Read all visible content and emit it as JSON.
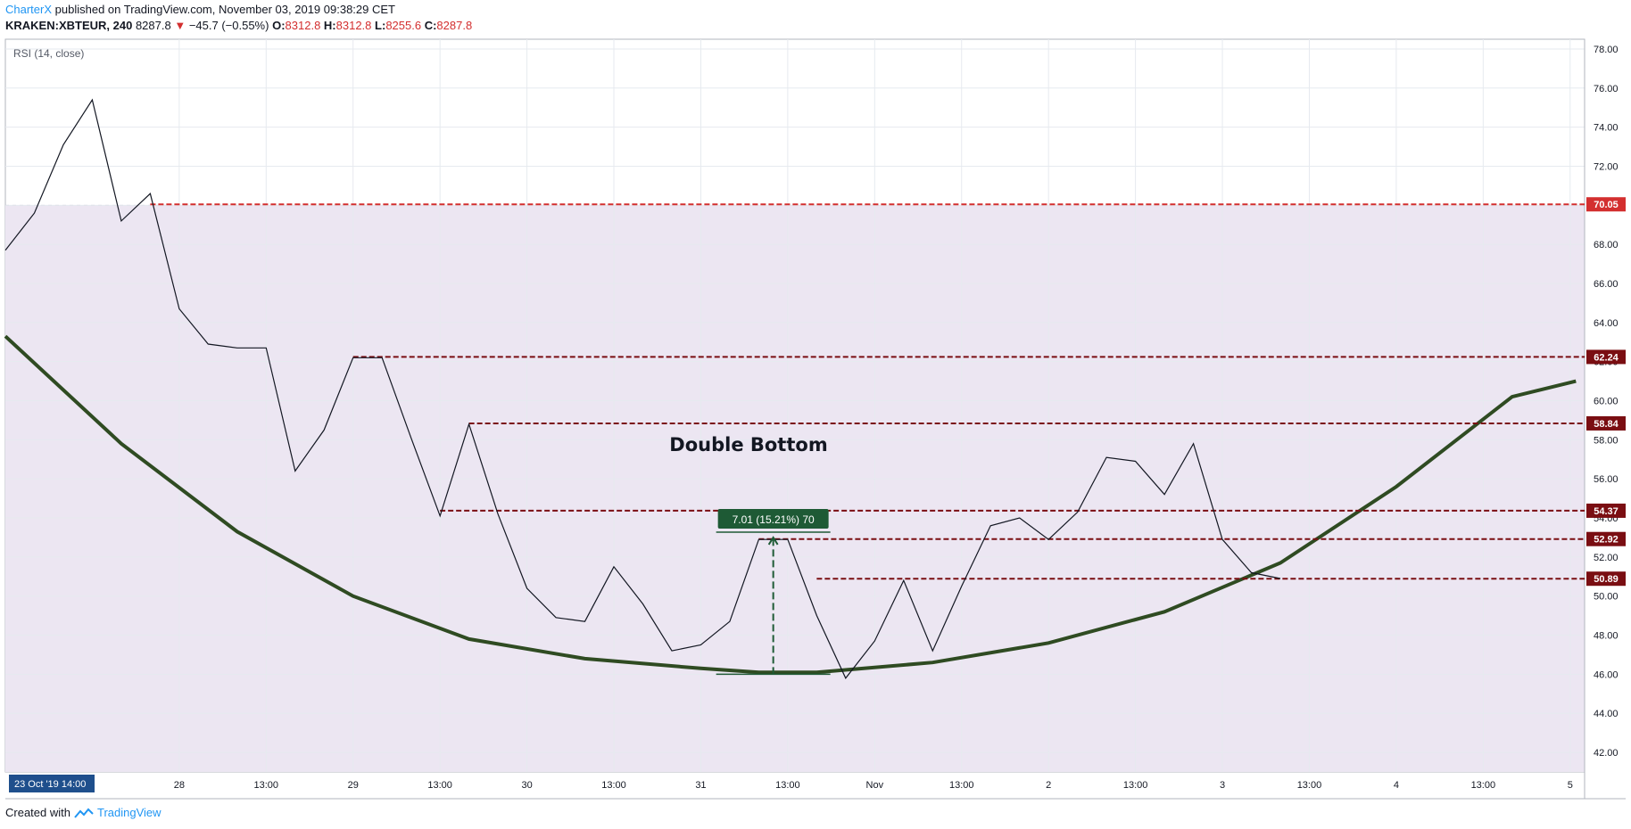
{
  "header": {
    "author": "CharterX",
    "published_text": "published on TradingView.com, November 03, 2019 09:38:29 CET",
    "symbol": "KRAKEN:XBTEUR, 240",
    "last": "8287.8",
    "change_arrow": "▼",
    "change": "−45.7 (−0.55%)",
    "open_label": "O:",
    "open": "8312.8",
    "high_label": "H:",
    "high": "8312.8",
    "low_label": "L:",
    "low": "8255.6",
    "close_label": "C:",
    "close": "8287.8"
  },
  "footer": {
    "created_with": "Created with",
    "brand": "TradingView"
  },
  "colors": {
    "band": "#ece6f2",
    "level_red": "#d32f2f",
    "level_dark": "#7a0e12",
    "arc": "#2f4b22",
    "measure": "#1e5a35",
    "rsi_line": "#131722",
    "grid": "#e6eaef"
  },
  "chart_data": {
    "type": "line",
    "indicator_label": "RSI (14, close)",
    "annotation": "Double Bottom",
    "measure_label": "7.01 (15.21%) 70",
    "ylim": [
      41,
      78.5
    ],
    "y_ticks": [
      "78.00",
      "76.00",
      "74.00",
      "72.00",
      "70.00",
      "68.00",
      "66.00",
      "64.00",
      "62.00",
      "60.00",
      "58.00",
      "56.00",
      "54.00",
      "52.00",
      "50.00",
      "48.00",
      "46.00",
      "44.00",
      "42.00"
    ],
    "x_ticks": [
      {
        "label": "28",
        "x": 6
      },
      {
        "label": "13:00",
        "x": 9
      },
      {
        "label": "29",
        "x": 12
      },
      {
        "label": "13:00",
        "x": 15
      },
      {
        "label": "30",
        "x": 18
      },
      {
        "label": "13:00",
        "x": 21
      },
      {
        "label": "31",
        "x": 24
      },
      {
        "label": "13:00",
        "x": 27
      },
      {
        "label": "Nov",
        "x": 30
      },
      {
        "label": "13:00",
        "x": 33
      },
      {
        "label": "2",
        "x": 36
      },
      {
        "label": "13:00",
        "x": 39
      },
      {
        "label": "3",
        "x": 42
      },
      {
        "label": "13:00",
        "x": 45
      },
      {
        "label": "4",
        "x": 48
      },
      {
        "label": "13:00",
        "x": 51
      },
      {
        "label": "5",
        "x": 54
      }
    ],
    "x_range": [
      0,
      54.5
    ],
    "start_label": "23 Oct '19   14:00",
    "rsi_x": [
      0,
      1,
      2,
      3,
      4,
      5,
      6,
      7,
      8,
      9,
      10,
      11,
      12,
      13,
      14,
      15,
      16,
      17,
      18,
      19,
      20,
      21,
      22,
      23,
      24,
      25,
      26,
      27,
      28,
      29,
      30,
      31,
      32,
      33,
      34,
      35,
      36,
      37,
      38,
      39,
      40,
      41,
      42,
      43,
      44
    ],
    "rsi_y": [
      67.7,
      69.6,
      73.1,
      75.4,
      69.2,
      70.6,
      64.7,
      62.9,
      62.7,
      62.7,
      56.4,
      58.5,
      62.2,
      62.2,
      58.1,
      54.1,
      58.8,
      54.2,
      50.4,
      48.9,
      48.7,
      51.5,
      49.6,
      47.2,
      47.5,
      48.7,
      52.9,
      52.9,
      49.0,
      45.8,
      47.7,
      50.8,
      47.2,
      50.5,
      53.6,
      54.0,
      52.9,
      54.3,
      57.1,
      56.9,
      55.2,
      57.8,
      52.9,
      51.2,
      50.9
    ],
    "band": [
      30,
      70
    ],
    "levels": [
      {
        "value": 70.05,
        "label": "70.05",
        "color": "#d32f2f",
        "x_start": 5
      },
      {
        "value": 62.24,
        "label": "62.24",
        "color": "#7a0e12",
        "x_start": 12
      },
      {
        "value": 58.84,
        "label": "58.84",
        "color": "#7a0e12",
        "x_start": 16
      },
      {
        "value": 54.37,
        "label": "54.37",
        "color": "#7a0e12",
        "x_start": 15
      },
      {
        "value": 52.92,
        "label": "52.92",
        "color": "#7a0e12",
        "x_start": 26
      },
      {
        "value": 50.89,
        "label": "50.89",
        "color": "#7a0e12",
        "x_start": 28
      }
    ],
    "arc": [
      [
        0,
        63.3
      ],
      [
        4,
        57.8
      ],
      [
        8,
        53.3
      ],
      [
        12,
        50.0
      ],
      [
        16,
        47.8
      ],
      [
        20,
        46.8
      ],
      [
        24,
        46.3
      ],
      [
        26,
        46.1
      ],
      [
        28,
        46.1
      ],
      [
        32,
        46.6
      ],
      [
        36,
        47.6
      ],
      [
        40,
        49.2
      ],
      [
        44,
        51.7
      ],
      [
        48,
        55.6
      ],
      [
        52,
        60.2
      ],
      [
        54.2,
        61.0
      ]
    ],
    "measure": {
      "x": 26.5,
      "y_from": 46.0,
      "y_to": 53.0
    }
  }
}
